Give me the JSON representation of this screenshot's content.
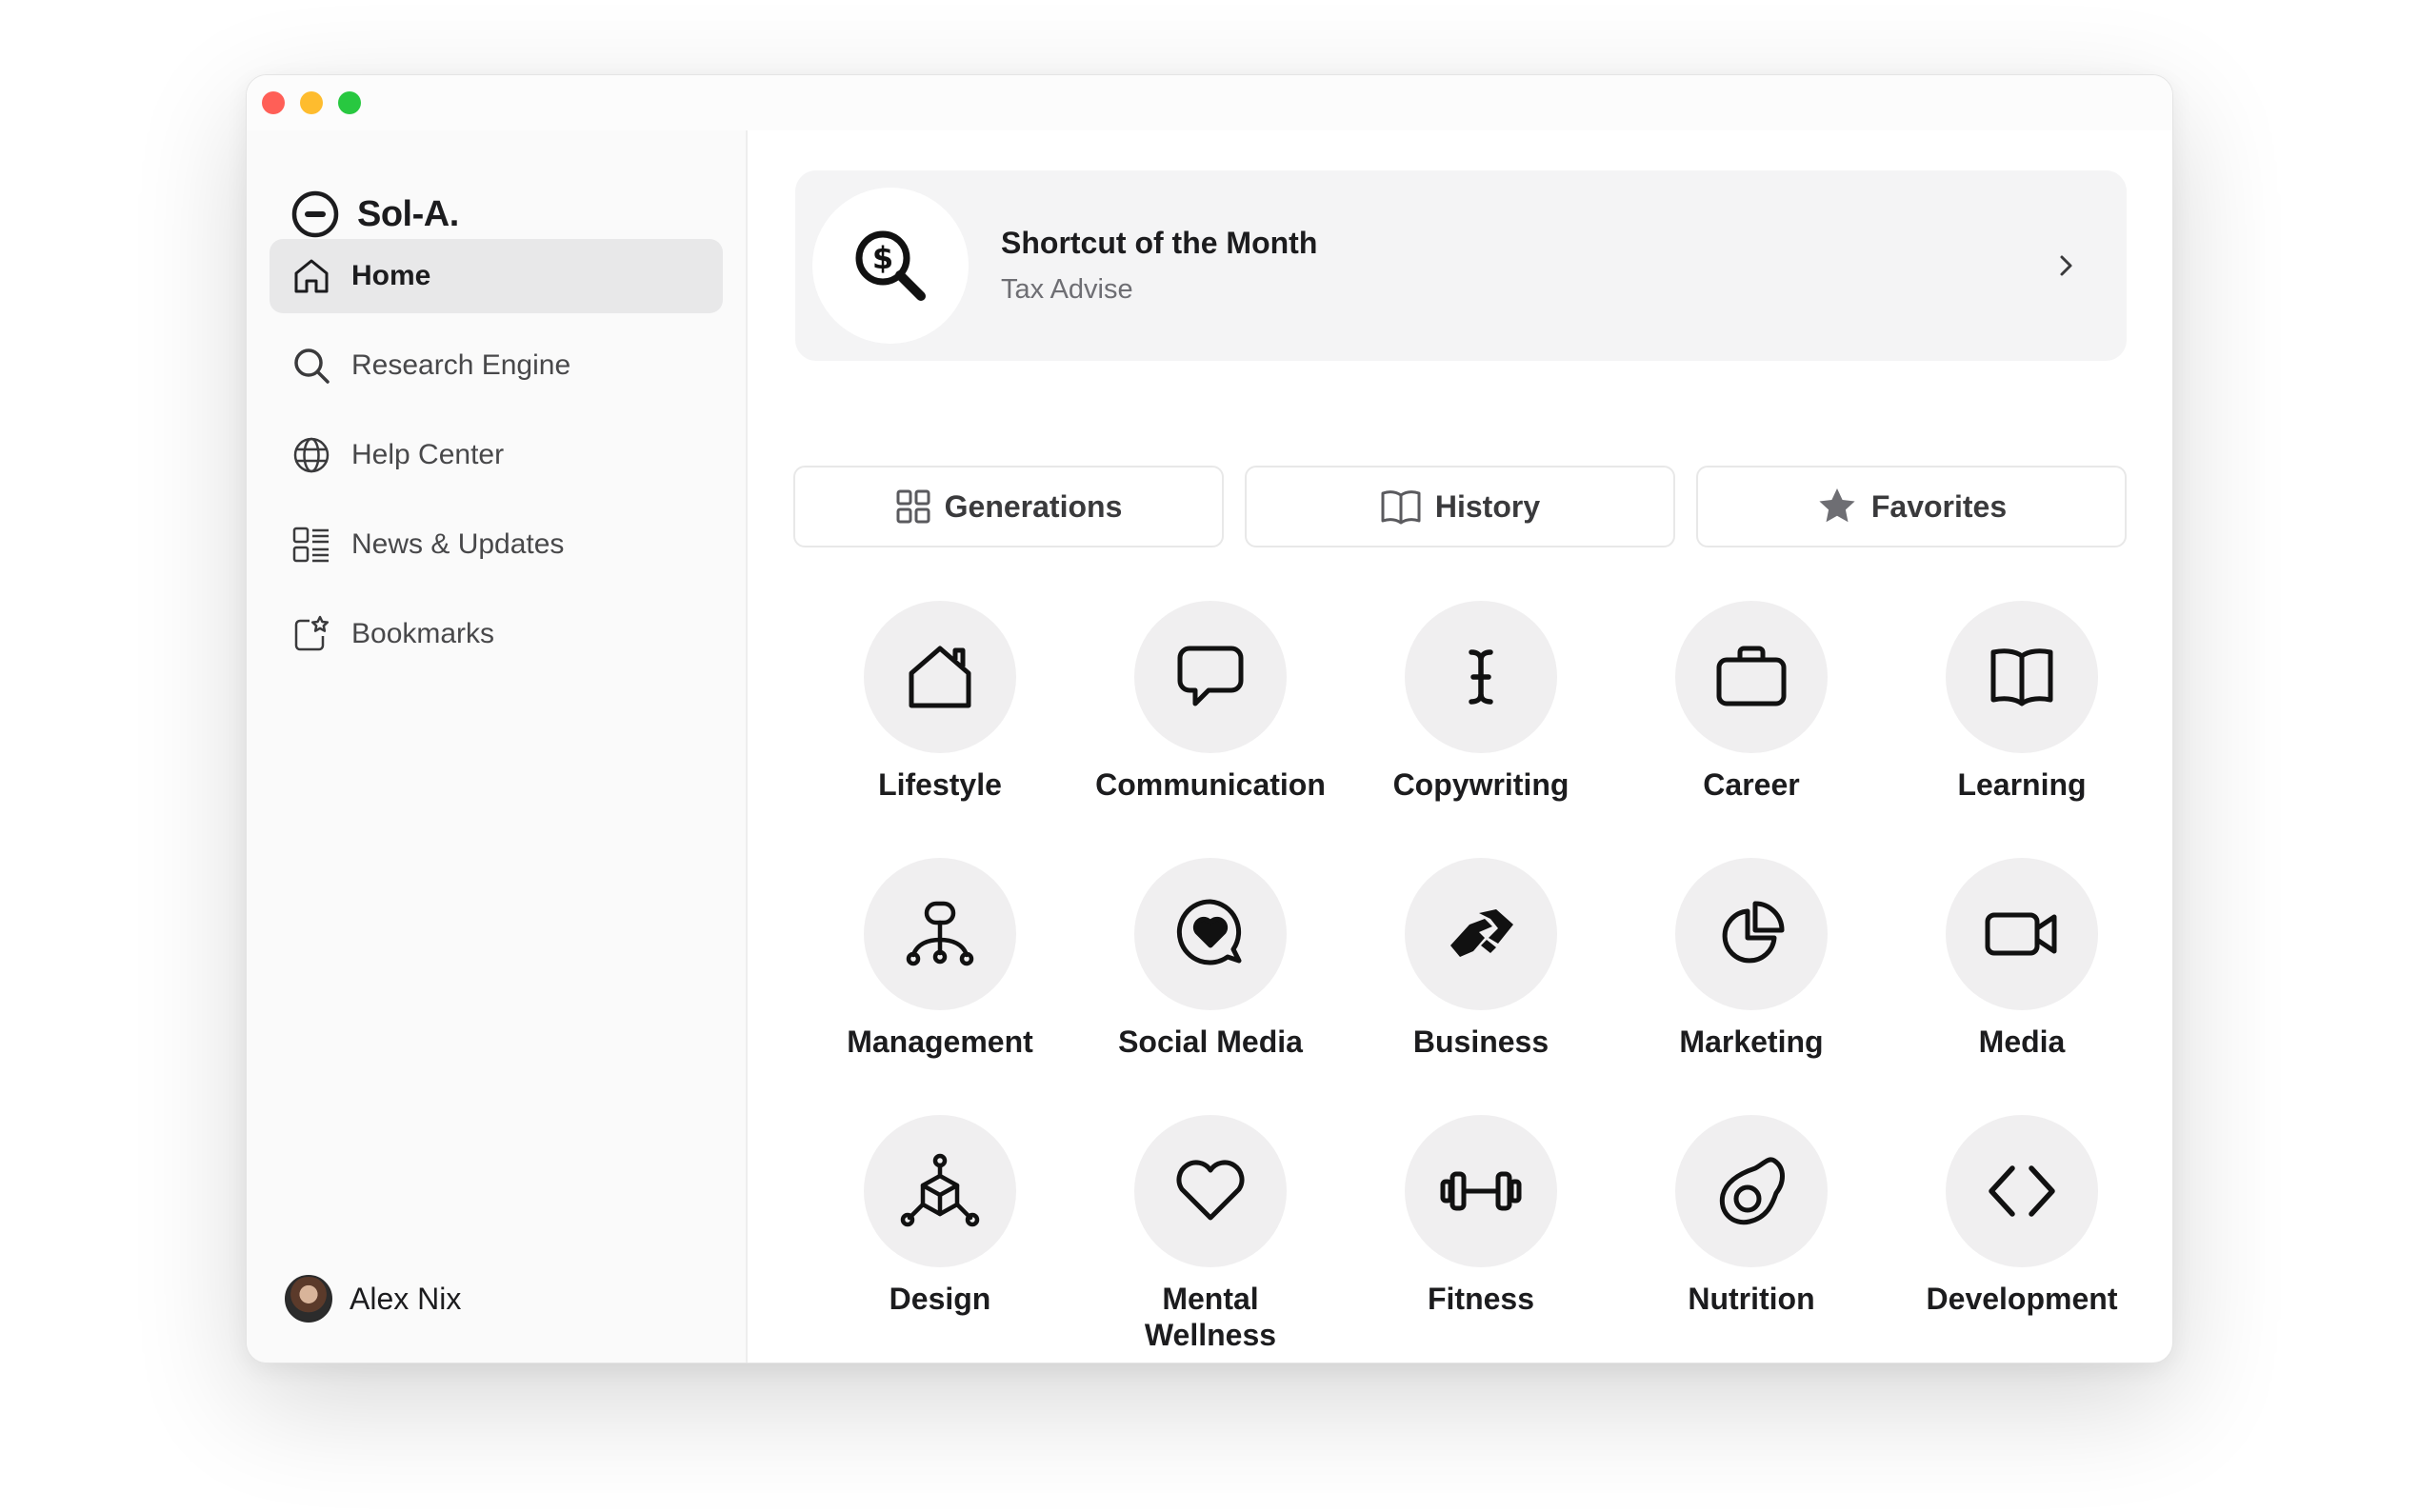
{
  "app": {
    "brand": "Sol-A."
  },
  "sidebar": {
    "items": [
      {
        "label": "Home",
        "icon": "home-icon",
        "active": true
      },
      {
        "label": "Research Engine",
        "icon": "search-icon"
      },
      {
        "label": "Help Center",
        "icon": "globe-icon"
      },
      {
        "label": "News & Updates",
        "icon": "list-icon"
      },
      {
        "label": "Bookmarks",
        "icon": "bookmark-icon"
      }
    ],
    "user": {
      "name": "Alex Nix"
    }
  },
  "shortcut": {
    "title": "Shortcut of the Month",
    "subtitle": "Tax Advise",
    "icon": "dollar-search-icon"
  },
  "tabs": [
    {
      "label": "Generations",
      "icon": "grid-icon"
    },
    {
      "label": "History",
      "icon": "book-icon"
    },
    {
      "label": "Favorites",
      "icon": "star-icon"
    }
  ],
  "categories": [
    {
      "label": "Lifestyle",
      "icon": "house-icon"
    },
    {
      "label": "Communication",
      "icon": "chat-bubble-icon"
    },
    {
      "label": "Copywriting",
      "icon": "text-cursor-icon"
    },
    {
      "label": "Career",
      "icon": "briefcase-icon"
    },
    {
      "label": "Learning",
      "icon": "open-book-icon"
    },
    {
      "label": "Management",
      "icon": "hierarchy-icon"
    },
    {
      "label": "Social Media",
      "icon": "heart-chat-icon"
    },
    {
      "label": "Business",
      "icon": "handshake-icon"
    },
    {
      "label": "Marketing",
      "icon": "pie-chart-icon"
    },
    {
      "label": "Media",
      "icon": "video-camera-icon"
    },
    {
      "label": "Design",
      "icon": "cube-network-icon"
    },
    {
      "label": "Mental\nWellness",
      "icon": "heart-icon"
    },
    {
      "label": "Fitness",
      "icon": "dumbbell-icon"
    },
    {
      "label": "Nutrition",
      "icon": "avocado-icon"
    },
    {
      "label": "Development",
      "icon": "code-icon"
    }
  ],
  "colors": {
    "traffic_red": "#ff5f57",
    "traffic_yellow": "#febc2e",
    "traffic_green": "#28c840",
    "active_nav": "#e8e8e9",
    "card_bg": "#f4f4f5",
    "icon_circle": "#f0eff0"
  }
}
